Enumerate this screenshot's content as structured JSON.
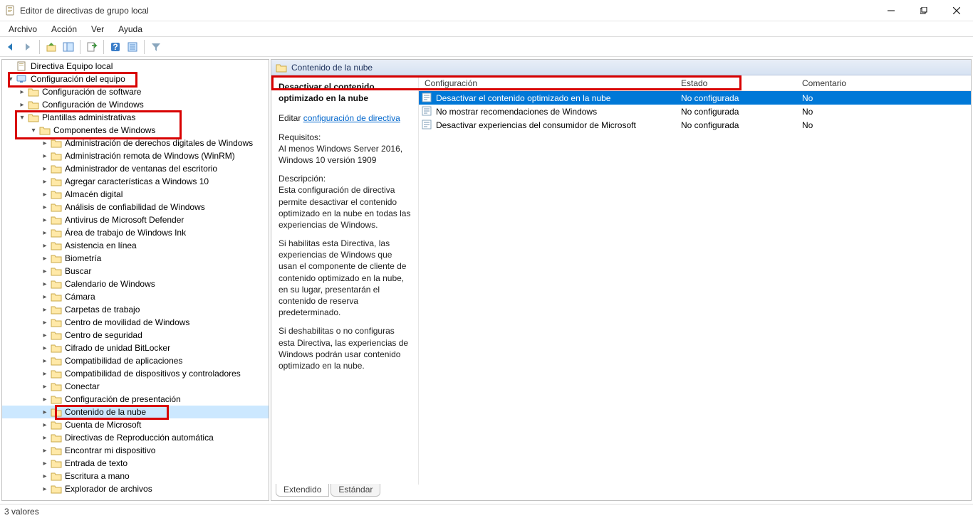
{
  "window": {
    "title": "Editor de directivas de grupo local",
    "min": "Minimize",
    "max": "Restore",
    "close": "Close"
  },
  "menu": {
    "archivo": "Archivo",
    "accion": "Acción",
    "ver": "Ver",
    "ayuda": "Ayuda"
  },
  "tree": {
    "root": "Directiva Equipo local",
    "computer_config": "Configuración del equipo",
    "software_config": "Configuración de software",
    "windows_config": "Configuración de Windows",
    "admin_templates": "Plantillas administrativas",
    "windows_components": "Componentes de Windows",
    "items": [
      "Administración de derechos digitales de Windows",
      "Administración remota de Windows (WinRM)",
      "Administrador de ventanas del escritorio",
      "Agregar características a Windows 10",
      "Almacén digital",
      "Análisis de confiabilidad de Windows",
      "Antivirus de Microsoft Defender",
      "Área de trabajo de Windows Ink",
      "Asistencia en línea",
      "Biometría",
      "Buscar",
      "Calendario de Windows",
      "Cámara",
      "Carpetas de trabajo",
      "Centro de movilidad de Windows",
      "Centro de seguridad",
      "Cifrado de unidad BitLocker",
      "Compatibilidad de aplicaciones",
      "Compatibilidad de dispositivos y controladores",
      "Conectar",
      "Configuración de presentación",
      "Contenido de la nube",
      "Cuenta de Microsoft",
      "Directivas de Reproducción automática",
      "Encontrar mi dispositivo",
      "Entrada de texto",
      "Escritura a mano",
      "Explorador de archivos"
    ],
    "selected_index": 21
  },
  "right": {
    "header": "Contenido de la nube",
    "policy_title": "Desactivar el contenido optimizado en la nube",
    "edit_label": "Editar",
    "policy_link": "configuración de directiva",
    "req_label": "Requisitos:",
    "req_1": "Al menos Windows Server 2016, Windows 10 versión 1909",
    "desc_label": "Descripción:",
    "desc_1": "Esta configuración de directiva permite desactivar el contenido optimizado en la nube en todas las experiencias de Windows.",
    "desc_2": "Si habilitas esta Directiva, las experiencias de Windows que usan el componente de cliente de contenido optimizado en la nube, en su lugar, presentarán el contenido de reserva predeterminado.",
    "desc_3": "Si deshabilitas o no configuras esta Directiva, las experiencias de Windows podrán usar contenido optimizado en la nube.",
    "cols": {
      "c1": "Configuración",
      "c2": "Estado",
      "c3": "Comentario"
    },
    "rows": [
      {
        "name": "Desactivar el contenido optimizado en la nube",
        "state": "No configurada",
        "comment": "No",
        "selected": true
      },
      {
        "name": "No mostrar recomendaciones de Windows",
        "state": "No configurada",
        "comment": "No",
        "selected": false
      },
      {
        "name": "Desactivar experiencias del consumidor de Microsoft",
        "state": "No configurada",
        "comment": "No",
        "selected": false
      }
    ]
  },
  "tabs": {
    "extended": "Extendido",
    "standard": "Estándar"
  },
  "status": "3 valores"
}
